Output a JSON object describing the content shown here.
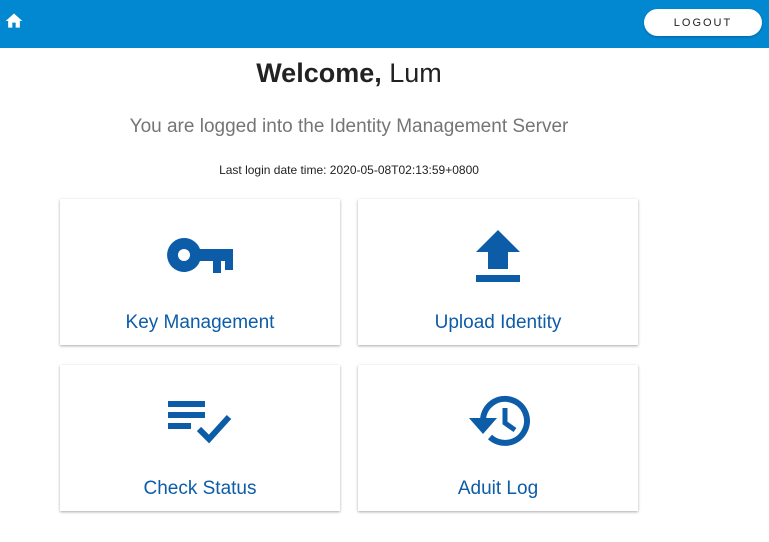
{
  "header": {
    "home_icon": "home-icon",
    "logout_label": "LOGOUT",
    "bar_color": "#0288d1"
  },
  "welcome": {
    "prefix": "Welcome,",
    "username": "Lum"
  },
  "subtitle": "You are logged into the Identity Management Server",
  "last_login": "Last login date time: 2020-05-08T02:13:59+0800",
  "cards": [
    {
      "label": "Key Management",
      "icon": "key-icon"
    },
    {
      "label": "Upload Identity",
      "icon": "upload-icon"
    },
    {
      "label": "Check Status",
      "icon": "playlist-check-icon"
    },
    {
      "label": "Aduit Log",
      "icon": "history-icon"
    }
  ],
  "accent_color": "#0d5ca8"
}
